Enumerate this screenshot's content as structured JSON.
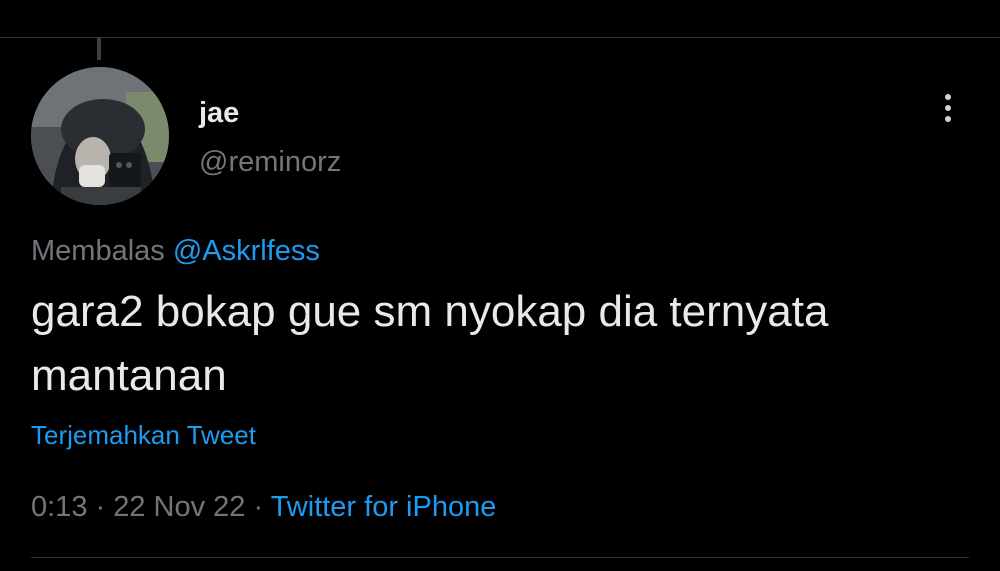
{
  "author": {
    "display_name": "jae",
    "handle": "@reminorz",
    "avatar_icon": "profile-photo-helmet"
  },
  "reply": {
    "prefix": "Membalas ",
    "mention": "@Askrlfess"
  },
  "tweet": {
    "text": "gara2 bokap gue sm nyokap dia ternyata mantanan"
  },
  "actions": {
    "translate_label": "Terjemahkan Tweet",
    "more_icon": "more-vertical-icon"
  },
  "meta": {
    "time": "0:13",
    "separator": " · ",
    "date": "22 Nov 22",
    "source": "Twitter for iPhone"
  },
  "colors": {
    "background": "#000000",
    "text_primary": "#e7e9ea",
    "text_secondary": "#71767b",
    "accent": "#1d9bf0",
    "divider": "#2f3336"
  }
}
